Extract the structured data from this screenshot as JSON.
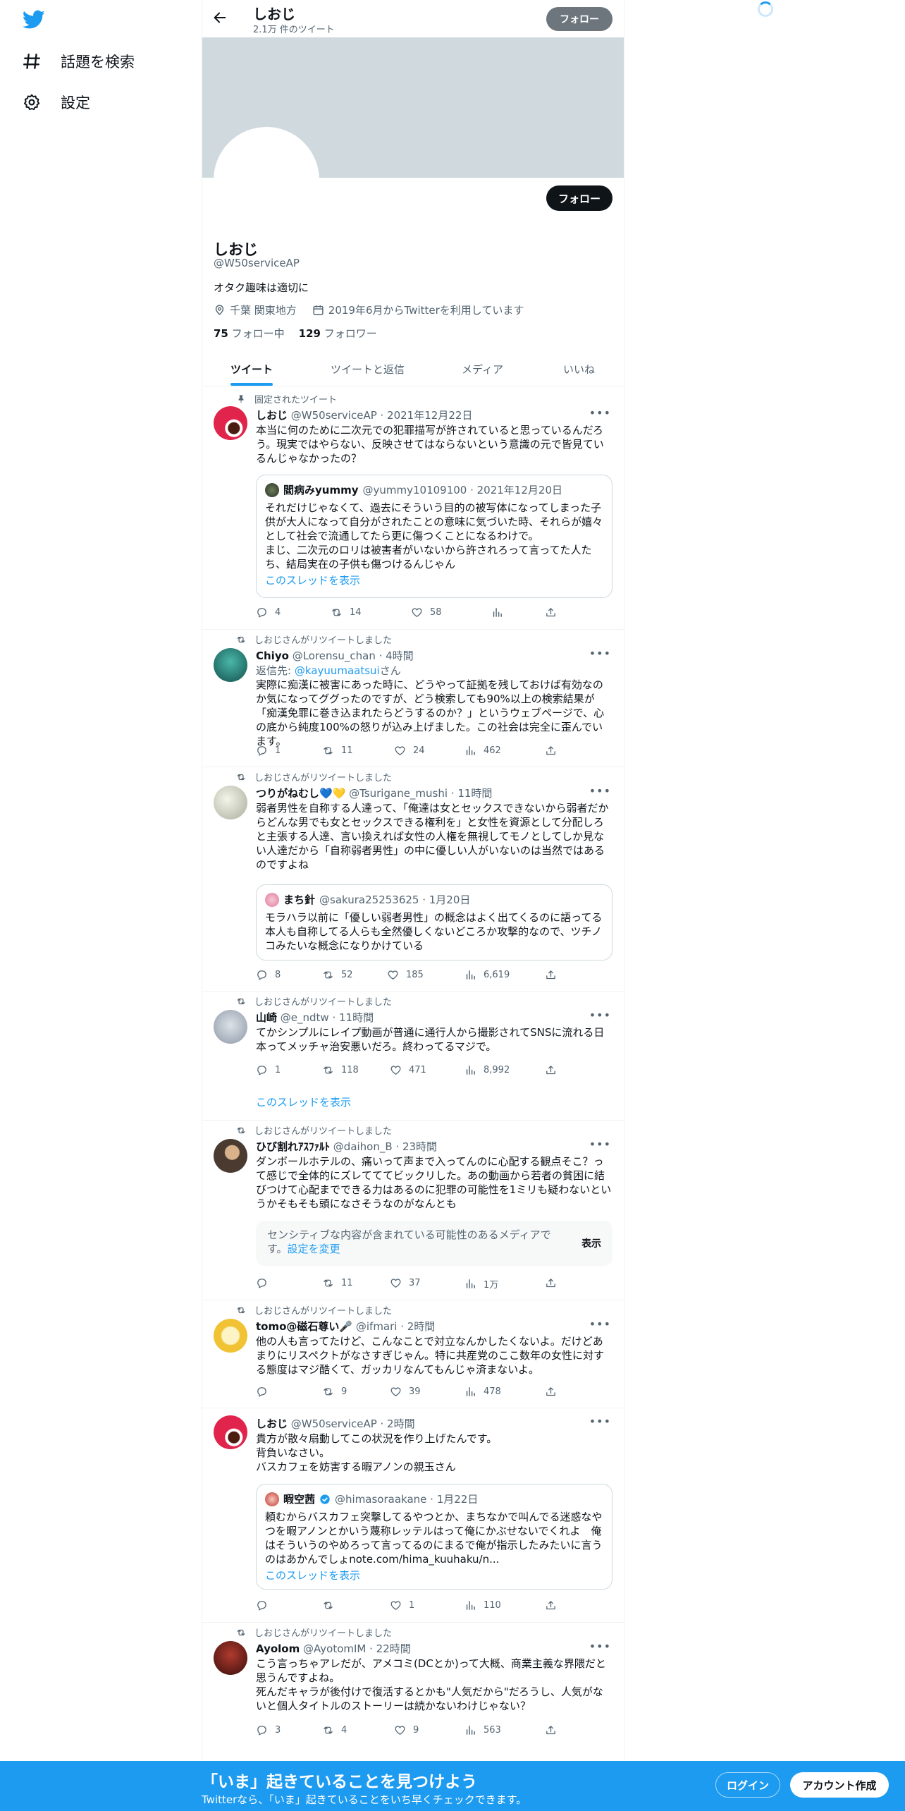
{
  "nav": {
    "explore_label": "話題を検索",
    "settings_label": "設定"
  },
  "header": {
    "name": "しおじ",
    "tweet_count": "2.1万 件のツイート",
    "follow_label": "フォロー"
  },
  "profile": {
    "follow_label": "フォロー",
    "name": "しおじ",
    "handle": "@W50serviceAP",
    "bio": "オタク趣味は適切に",
    "location": "千葉 関東地方",
    "joined": "2019年6月からTwitterを利用しています",
    "following_count": "75",
    "following_label": "フォロー中",
    "followers_count": "129",
    "followers_label": "フォロワー"
  },
  "tabs": [
    "ツイート",
    "ツイートと返信",
    "メディア",
    "いいね"
  ],
  "tweets": [
    {
      "context": "固定されたツイート",
      "name": "しおじ",
      "meta": "@W50serviceAP · 2021年12月22日",
      "text": "本当に何のために二次元での犯罪描写が許されていると思っているんだろう。現実ではやらない、反映させてはならないという意識の元で皆見ているんじゃなかったの？",
      "quote": {
        "name": "閻病みyummy",
        "meta": "@yummy10109100 · 2021年12月20日",
        "text": "それだけじゃなくて、過去にそういう目的の被写体になってしまった子供が大人になって自分がされたことの意味に気づいた時、それらが嬉々として社会で流通してたら更に傷つくことになるわけで。\nまじ、二次元のロリは被害者がいないから許されろって言ってた人たち、結局実在の子供も傷つけるんじゃん",
        "thread": "このスレッドを表示"
      },
      "replies": "4",
      "retweets": "14",
      "likes": "58",
      "views": ""
    },
    {
      "context": "しおじさんがリツイートしました",
      "name": "Chiyo",
      "meta": "@Lorensu_chan · 4時間",
      "reply_prefix": "返信先: ",
      "reply_to": "@kayuumaatsui",
      "reply_suffix": "さん",
      "text": "実際に痴漢に被害にあった時に、どうやって証拠を残しておけば有効なのか気になってググったのですが、どう検索しても90%以上の検索結果が「痴漢免罪に巻き込まれたらどうするのか？」というウェブページで、心の底から純度100%の怒りが込み上げました。この社会は完全に歪んでいます。",
      "replies": "1",
      "retweets": "11",
      "likes": "24",
      "views": "462"
    },
    {
      "context": "しおじさんがリツイートしました",
      "name": "つりがねむし💙💛",
      "meta": "@Tsurigane_mushi · 11時間",
      "text": "弱者男性を自称する人達って、「俺達は女とセックスできないから弱者だからどんな男でも女とセックスできる権利を」と女性を資源として分配しろと主張する人達、言い換えれば女性の人権を無視してモノとしてしか見ない人達だから「自称弱者男性」の中に優しい人がいないのは当然ではあるのですよね",
      "quote": {
        "name": "まち針",
        "meta": "@sakura25253625 · 1月20日",
        "text": "モラハラ以前に「優しい弱者男性」の概念はよく出てくるのに語ってる本人も自称してる人らも全然優しくないどころか攻撃的なので、ツチノコみたいな概念になりかけている"
      },
      "replies": "8",
      "retweets": "52",
      "likes": "185",
      "views": "6,619"
    },
    {
      "context": "しおじさんがリツイートしました",
      "name": "山崎",
      "meta": "@e_ndtw · 11時間",
      "text": "てかシンプルにレイプ動画が普通に通行人から撮影されてSNSに流れる日本ってメッチャ治安悪いだろ。終わってるマジで。",
      "replies": "1",
      "retweets": "118",
      "likes": "471",
      "views": "8,992",
      "thread": "このスレッドを表示"
    },
    {
      "context": "しおじさんがリツイートしました",
      "name": "ひび割れｱｽﾌｧﾙﾄ",
      "meta": "@daihon_B · 23時間",
      "text": "ダンボールホテルの、痛いって声まで入ってんのに心配する観点そこ？って感じで全体的にズレてててビックリした。あの動画から若者の貧困に結びつけて心配までできる力はあるのに犯罪の可能性を1ミリも疑わないというかそもそも頭になさそうなのがなんとも",
      "sensitive_text": "センシティブな内容が含まれている可能性のあるメディアです。",
      "sensitive_link": "設定を変更",
      "sensitive_button": "表示",
      "replies": "",
      "retweets": "11",
      "likes": "37",
      "views": "1万"
    },
    {
      "context": "しおじさんがリツイートしました",
      "name": "tomo@磁石尊い🎤",
      "meta": "@ifmari · 2時間",
      "text": "他の人も言ってたけど、こんなことで対立なんかしたくないよ。だけどあまりにリスペクトがなさすぎじゃん。特に共産党のここ数年の女性に対する態度はマジ酷くて、ガッカリなんてもんじゃ済まないよ。",
      "replies": "",
      "retweets": "9",
      "likes": "39",
      "views": "478"
    },
    {
      "context": "",
      "name": "しおじ",
      "meta": "@W50serviceAP · 2時間",
      "text": "貴方が散々扇動してこの状況を作り上げたんです。\n背負いなさい。\nバスカフェを妨害する暇アノンの親玉さん",
      "quote": {
        "name": "暇空茜",
        "meta": "@himasoraakane · 1月22日",
        "text": "頼むからバスカフェ突撃してるやつとか、まちなかで叫んでる迷惑なやつを暇アノンとかいう蔑称レッテルはって俺にかぶせないでくれよ　俺はそういうのやめろって言ってるのにまるで俺が指示したみたいに言うのはあかんでしょnote.com/hima_kuuhaku/n...",
        "thread": "このスレッドを表示"
      },
      "replies": "",
      "retweets": "",
      "likes": "1",
      "views": "110"
    },
    {
      "context": "しおじさんがリツイートしました",
      "name": "Ayolom",
      "meta": "@AyotomIM · 22時間",
      "text": "こう言っちゃアレだが、アメコミ(DCとか)って大概、商業主義な界隈だと思うんですよね。\n死んだキャラが後付けで復活するとかも\"人気だから\"だろうし、人気がないと個人タイトルのストーリーは続かないわけじゃない？",
      "replies": "3",
      "retweets": "4",
      "likes": "9",
      "views": "563"
    }
  ],
  "bottombar": {
    "title": "「いま」起きていることを見つけよう",
    "subtitle": "Twitterなら、「いま」起きていることをいち早くチェックできます。",
    "login_label": "ログイン",
    "signup_label": "アカウント作成"
  },
  "colors": {
    "accent": "#1d9bf0",
    "text": "#0f1419",
    "muted": "#536471"
  }
}
